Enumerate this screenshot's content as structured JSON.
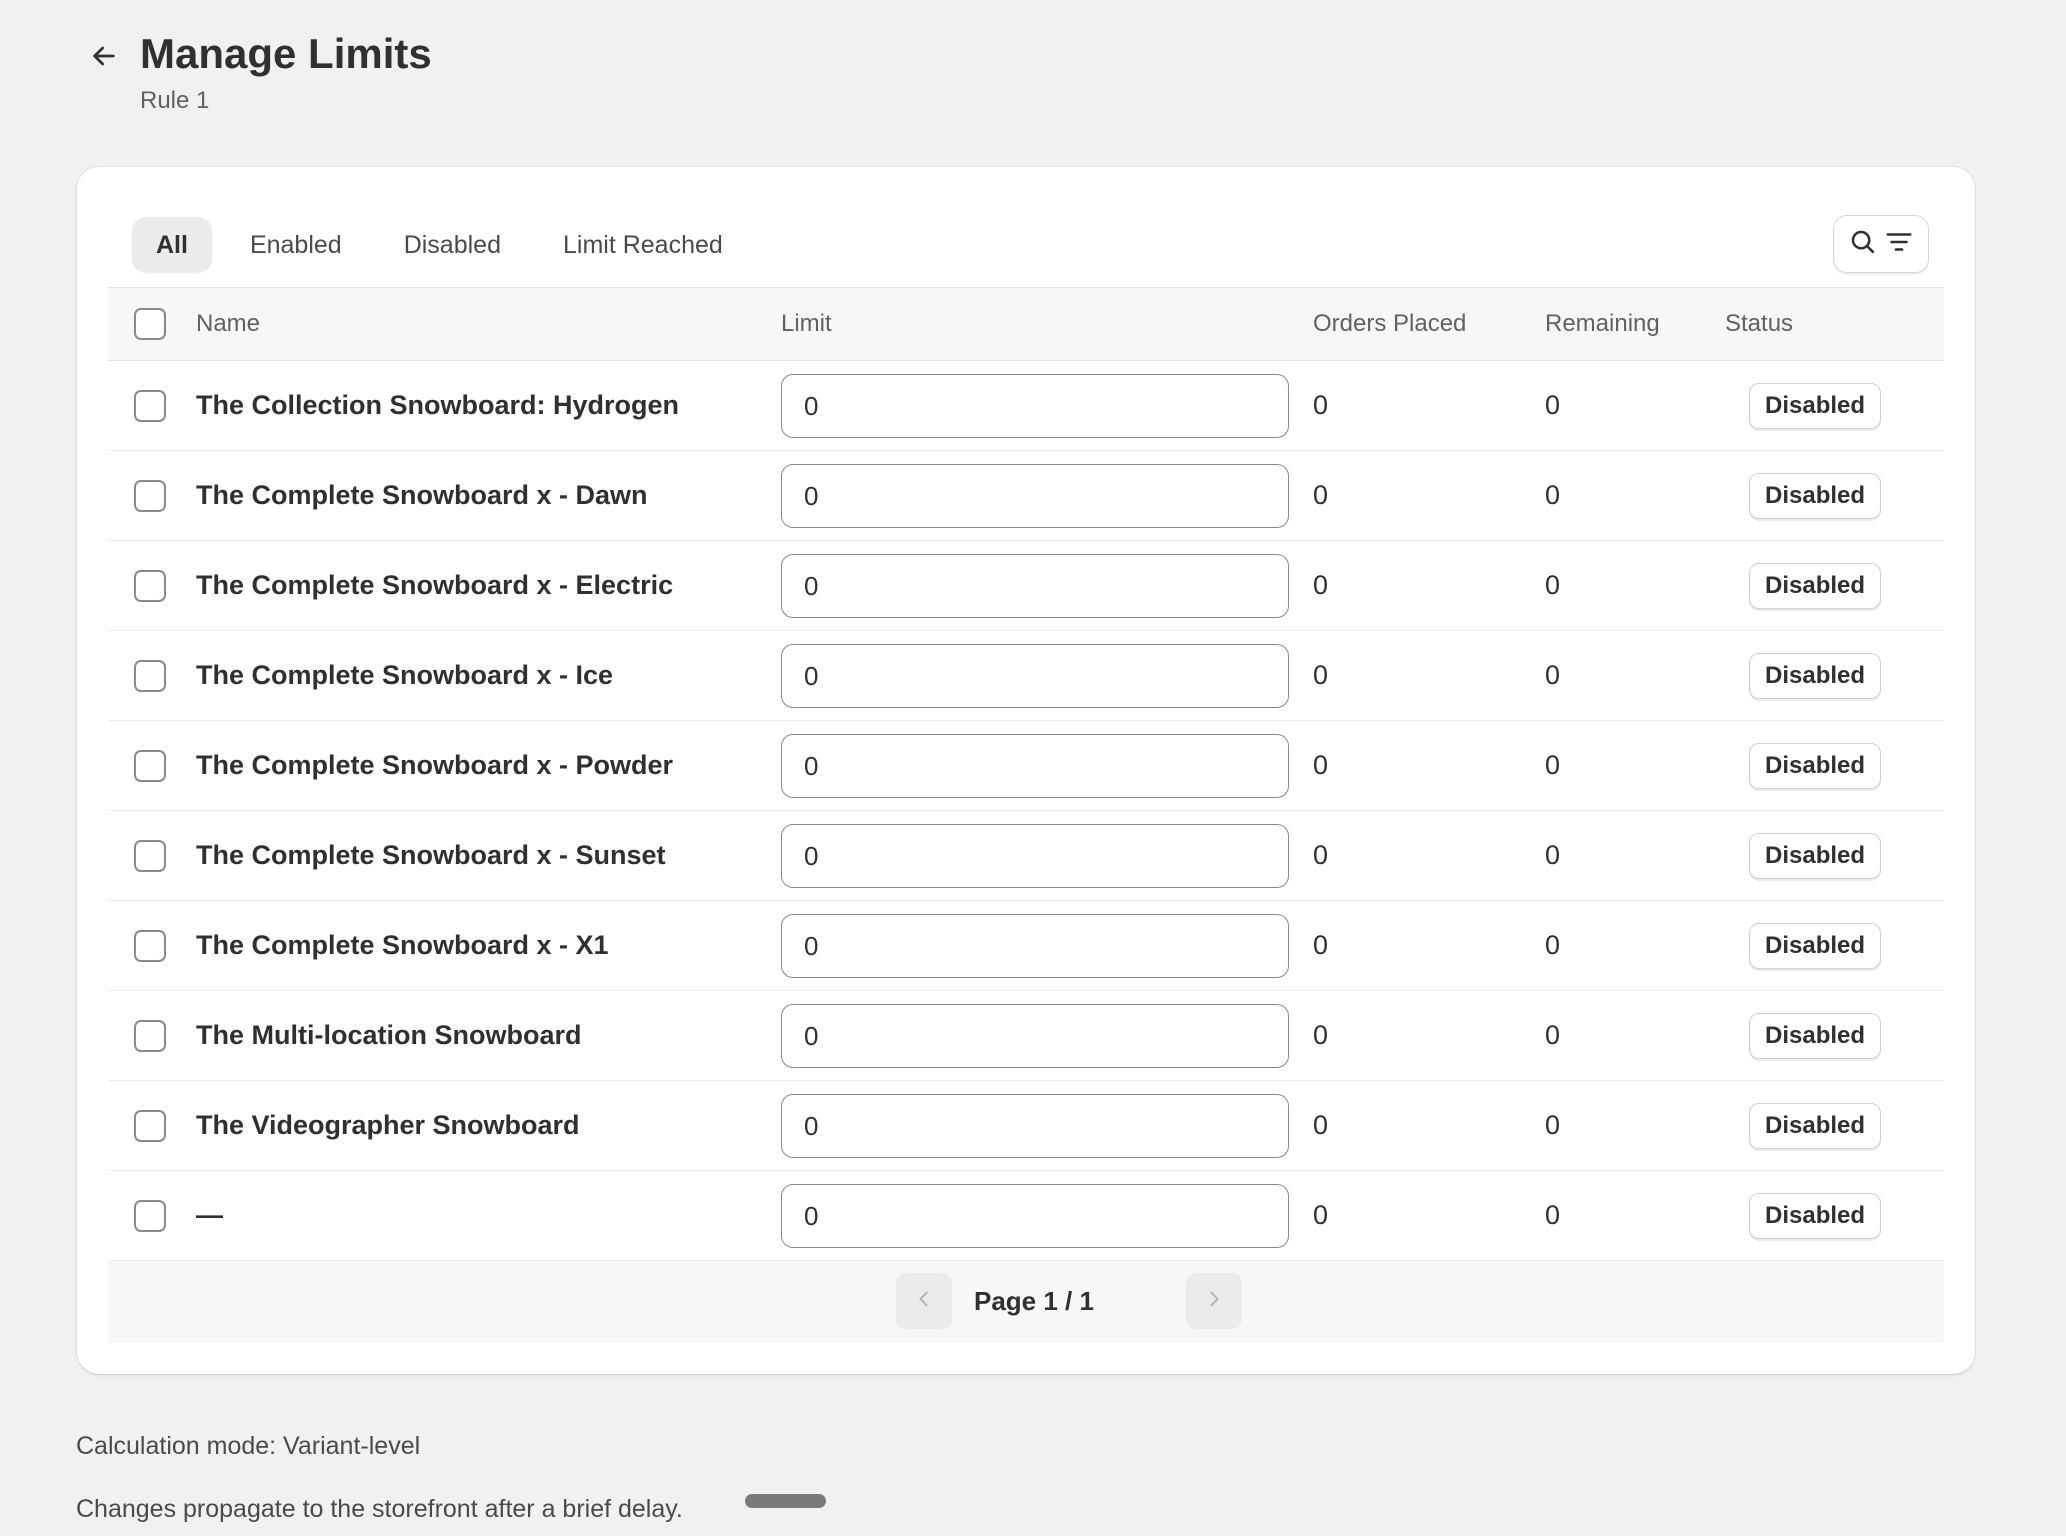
{
  "header": {
    "title": "Manage Limits",
    "subtitle": "Rule 1",
    "back_icon": "arrow-left-icon"
  },
  "tabs": [
    {
      "label": "All",
      "active": true
    },
    {
      "label": "Enabled",
      "active": false
    },
    {
      "label": "Disabled",
      "active": false
    },
    {
      "label": "Limit Reached",
      "active": false
    }
  ],
  "toolbar": {
    "search_icon": "search-icon",
    "filter_icon": "filter-icon"
  },
  "table": {
    "columns": {
      "name": "Name",
      "limit": "Limit",
      "orders_placed": "Orders Placed",
      "remaining": "Remaining",
      "status": "Status"
    },
    "rows": [
      {
        "name": "The Collection Snowboard: Hydrogen",
        "limit": "0",
        "orders_placed": "0",
        "remaining": "0",
        "status": "Disabled"
      },
      {
        "name": "The Complete Snowboard x - Dawn",
        "limit": "0",
        "orders_placed": "0",
        "remaining": "0",
        "status": "Disabled"
      },
      {
        "name": "The Complete Snowboard x - Electric",
        "limit": "0",
        "orders_placed": "0",
        "remaining": "0",
        "status": "Disabled"
      },
      {
        "name": "The Complete Snowboard x - Ice",
        "limit": "0",
        "orders_placed": "0",
        "remaining": "0",
        "status": "Disabled"
      },
      {
        "name": "The Complete Snowboard x - Powder",
        "limit": "0",
        "orders_placed": "0",
        "remaining": "0",
        "status": "Disabled"
      },
      {
        "name": "The Complete Snowboard x - Sunset",
        "limit": "0",
        "orders_placed": "0",
        "remaining": "0",
        "status": "Disabled"
      },
      {
        "name": "The Complete Snowboard x - X1",
        "limit": "0",
        "orders_placed": "0",
        "remaining": "0",
        "status": "Disabled"
      },
      {
        "name": "The Multi-location Snowboard",
        "limit": "0",
        "orders_placed": "0",
        "remaining": "0",
        "status": "Disabled"
      },
      {
        "name": "The Videographer Snowboard",
        "limit": "0",
        "orders_placed": "0",
        "remaining": "0",
        "status": "Disabled"
      },
      {
        "name": "—",
        "limit": "0",
        "orders_placed": "0",
        "remaining": "0",
        "status": "Disabled"
      }
    ]
  },
  "pagination": {
    "label": "Page 1 / 1",
    "prev_icon": "chevron-left-icon",
    "next_icon": "chevron-right-icon"
  },
  "footer": {
    "calculation_mode": "Calculation mode: Variant-level",
    "note": "Changes propagate to the storefront after a brief delay."
  }
}
